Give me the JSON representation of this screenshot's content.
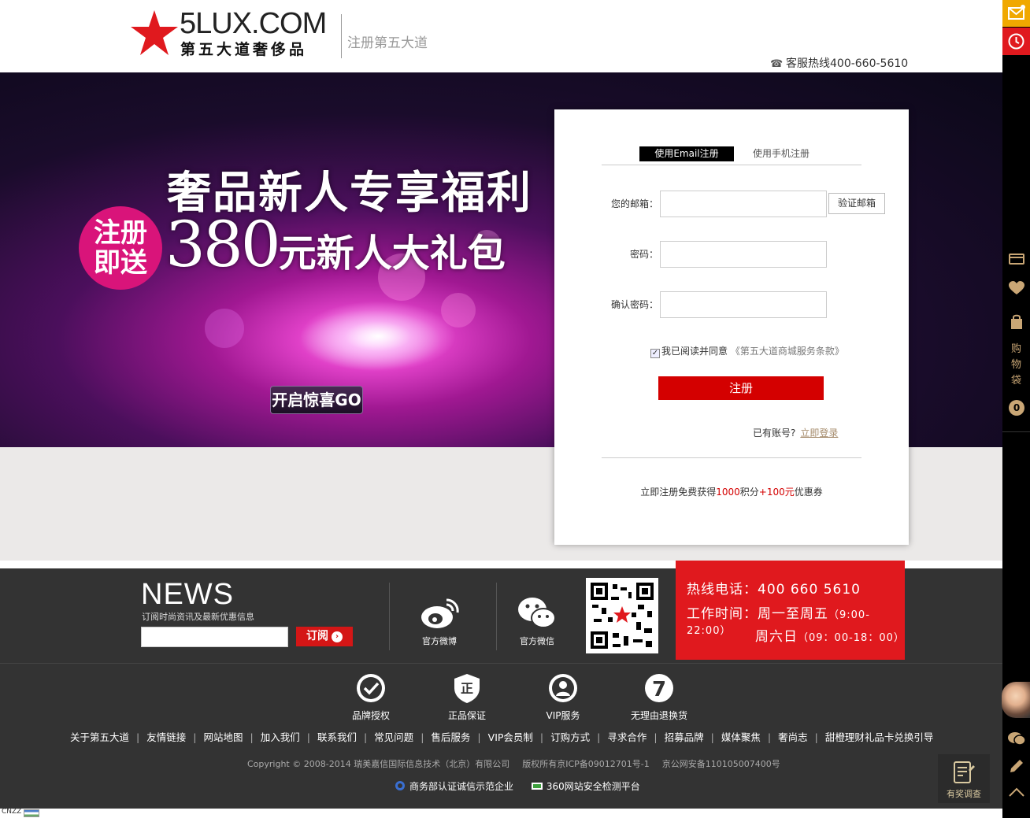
{
  "header": {
    "logo_en": "5LUX.COM",
    "logo_cn": "第五大道奢侈品",
    "title": "注册第五大道",
    "hotline": "客服热线400-660-5610"
  },
  "banner": {
    "line1": "奢品新人专享福利",
    "badge_line1": "注册",
    "badge_line2": "即送",
    "amount": "380",
    "line2_rest": "元新人大礼包",
    "go_button": "开启惊喜GO"
  },
  "register": {
    "tabs": [
      {
        "label": "使用Email注册",
        "active": true
      },
      {
        "label": "使用手机注册",
        "active": false
      }
    ],
    "email_label": "您的邮箱：",
    "email_value": "",
    "verify_button": "验证邮箱",
    "password_label": "密码：",
    "password_value": "",
    "confirm_label": "确认密码：",
    "confirm_value": "",
    "agree_checked": true,
    "agree_text": "我已阅读并同意",
    "terms_text": "《第五大道商城服务条款》",
    "submit": "注册",
    "has_account": "已有账号?",
    "login_link": "立即登录",
    "promo_pre": "立即注册免费获得",
    "promo_points": "1000",
    "promo_mid": "积分",
    "promo_coupon": "+100元",
    "promo_post": "优惠券"
  },
  "footer": {
    "news_title": "NEWS",
    "news_sub": "订阅时尚资讯及最新优惠信息",
    "news_input": "",
    "subscribe": "订阅",
    "weibo": "官方微博",
    "weixin": "官方微信",
    "hotline_line": "热线电话：400 660 5610",
    "hours_label": "工作时间：周一至周五",
    "hours_weekday": "（9:00-22:00）",
    "saturday": "周六日",
    "hours_weekend": "（09：00-18：00）",
    "services": [
      "品牌授权",
      "正品保证",
      "VIP服务",
      "无理由退换货"
    ],
    "links": [
      "关于第五大道",
      "友情链接",
      "网站地图",
      "加入我们",
      "联系我们",
      "常见问题",
      "售后服务",
      "VIP会员制",
      "订购方式",
      "寻求合作",
      "招募品牌",
      "媒体聚焦",
      "奢尚志",
      "甜橙理财礼品卡兑换引导"
    ],
    "copyright": "Copyright © 2008-2014 瑞美嘉信国际信息技术（北京）有限公司",
    "icp": "版权所有京ICP备09012701号-1",
    "police": "京公网安备110105007400号",
    "cert1": "商务部认证诚信示范企业",
    "cert2": "360网站安全检测平台",
    "survey": "有奖调查"
  },
  "sidebar": {
    "cart_label": "购物袋",
    "cart_count": "0"
  },
  "cnzz": "CNZZ",
  "colors": {
    "brand_red": "#e0191e",
    "submit_red": "#d40000",
    "gold": "#c9a675",
    "footer_bg": "#333333"
  }
}
